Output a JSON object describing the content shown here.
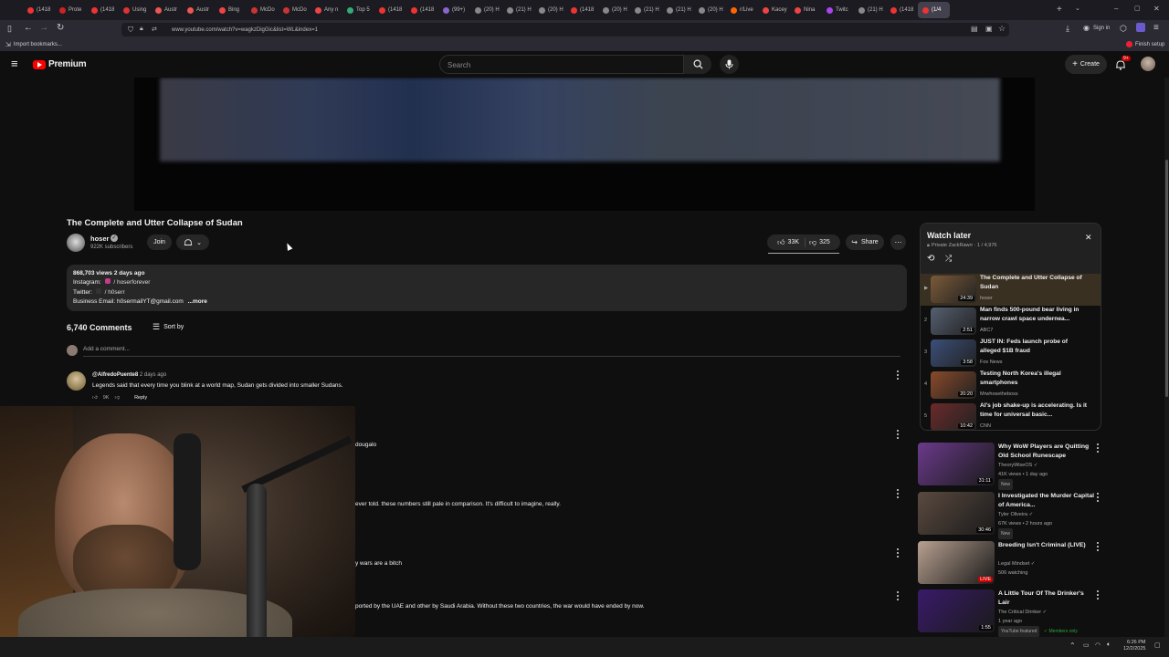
{
  "browser": {
    "tabs": [
      "(1418",
      "Prote",
      "(1418",
      "Using",
      "Austr",
      "Austr",
      "Bing",
      "McDo",
      "McDo",
      "Any n",
      "Top 5",
      "(1418",
      "(1418",
      "(99+)",
      "(20) H",
      "(21) H",
      "(20) H",
      "(1418",
      "(20) H",
      "(21) H",
      "(21) H",
      "(20) H",
      "r/Live",
      "Kacey",
      "Nina",
      "Twitc",
      "(21) H",
      "(1418",
      "(1/4"
    ],
    "url": "www.youtube.com/watch?v=wagkzDigGic&list=WL&index=1",
    "bookmark": "Import bookmarks...",
    "sign_in": "Sign in",
    "finish_setup": "Finish setup"
  },
  "header": {
    "logo": "Premium",
    "search_placeholder": "Search",
    "create_label": "Create",
    "notif_count": "9+"
  },
  "video": {
    "title": "The Complete and Utter Collapse of Sudan",
    "channel": "hoser",
    "subscribers": "922K subscribers",
    "join_label": "Join",
    "likes": "33K",
    "dislikes": "325",
    "share_label": "Share"
  },
  "description": {
    "stats": "868,703 views  2 days ago",
    "line_instagram_prefix": "Instagram:",
    "line_instagram": "/ hoserforever",
    "line_twitter_prefix": "Twitter:",
    "line_twitter": "/ h0serr",
    "line_email": "Business Email: h0sermailYT@gmail.com",
    "more": "...more"
  },
  "comments": {
    "count": "6,740 Comments",
    "sort_label": "Sort by",
    "add_placeholder": "Add a comment...",
    "first": {
      "author": "@AlfredoPuente8",
      "time": "2 days ago",
      "text": "Legends said that every time you blink at a world map, Sudan gets divided into smaller Sudans.",
      "likes": "9K",
      "reply_label": "Reply"
    },
    "partials": [
      "dougalo",
      "ever told. these numbers still pale in comparison. It's difficult to imagine, really.",
      "y wars are a bitch",
      "ported by the UAE and other by Saudi Arabia. Without these two countries, the war would have ended by now."
    ]
  },
  "watch_later": {
    "title": "Watch later",
    "owner": "Private  ZackRawrr · 1 / 4,976",
    "items": [
      {
        "index": "▶",
        "title": "The Complete and Utter Collapse of Sudan",
        "channel": "hoser",
        "duration": "24:39",
        "color": "#7a5a38"
      },
      {
        "index": "2",
        "title": "Man finds 500-pound bear living in narrow crawl space underneа...",
        "channel": "ABC7",
        "duration": "2:51",
        "color": "#556070"
      },
      {
        "index": "3",
        "title": "JUST IN: Feds launch probe of alleged $1B fraud",
        "channel": "Fox News",
        "duration": "3:58",
        "color": "#3b4f7a"
      },
      {
        "index": "4",
        "title": "Testing North Korea's illegal smartphones",
        "channel": "Mrwhosetheboss",
        "duration": "20:20",
        "color": "#8a4a2a"
      },
      {
        "index": "5",
        "title": "AI's job shake-up is accelerating. Is it time for universal basic...",
        "channel": "CNN",
        "duration": "10:42",
        "color": "#6b2a2a"
      }
    ]
  },
  "recommendations": [
    {
      "title": "Why WoW Players are Quitting Old School Runescape",
      "channel": "TheoryWiseOS",
      "meta": "41K views • 1 day ago",
      "badge": "New",
      "duration": "31:11",
      "color": "#6a3a8a"
    },
    {
      "title": "I Investigated the Murder Capital of America...",
      "channel": "Tyler Oliveira",
      "meta": "67K views • 2 hours ago",
      "badge": "New",
      "duration": "30:46",
      "color": "#5a4a40"
    },
    {
      "title": "Breeding Isn't Criminal (LIVE)",
      "channel": "Legal Mindset",
      "meta": "506 watching",
      "badge": "",
      "duration": "LIVE",
      "color": "#b8a090"
    },
    {
      "title": "A Little Tour Of The Drinker's Lair",
      "channel": "The Critical Drinker",
      "meta": "1 year ago",
      "badge": "YouTube featured",
      "badge2": "Members only",
      "duration": "1:55",
      "color": "#3a1a6a"
    }
  ],
  "taskbar": {
    "time": "6:26 PM",
    "date": "12/2/2025"
  }
}
